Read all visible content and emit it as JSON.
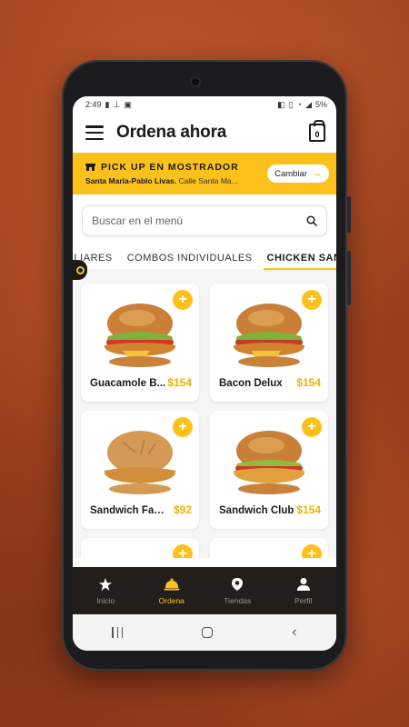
{
  "status": {
    "time": "2:49",
    "battery": "5%"
  },
  "appbar": {
    "title": "Ordena ahora",
    "bag_count": "0"
  },
  "pickup": {
    "heading": "PICK UP EN MOSTRADOR",
    "store": "Santa María-Pablo Livas.",
    "address": "Calle Santa Ma...",
    "change_label": "Cambiar"
  },
  "search": {
    "placeholder": "Buscar en el menú"
  },
  "tabs": [
    {
      "label": "ILIARES"
    },
    {
      "label": "COMBOS INDIVIDUALES"
    },
    {
      "label": "CHICKEN SANDWIC"
    }
  ],
  "products": [
    {
      "name": "Guacamole B...",
      "price": "$154"
    },
    {
      "name": "Bacon Delux",
      "price": "$154"
    },
    {
      "name": "Sandwich Faji...",
      "price": "$92"
    },
    {
      "name": "Sandwich Club",
      "price": "$154"
    }
  ],
  "nav": [
    {
      "label": "Inicio",
      "icon": "star-icon"
    },
    {
      "label": "Ordena",
      "icon": "cloche-icon"
    },
    {
      "label": "Tiendas",
      "icon": "location-pin-icon"
    },
    {
      "label": "Perfil",
      "icon": "person-icon"
    }
  ],
  "colors": {
    "accent": "#fcc21b",
    "price": "#f0b000",
    "nav_bg": "#231e1b",
    "backdrop": "#a2431f"
  }
}
